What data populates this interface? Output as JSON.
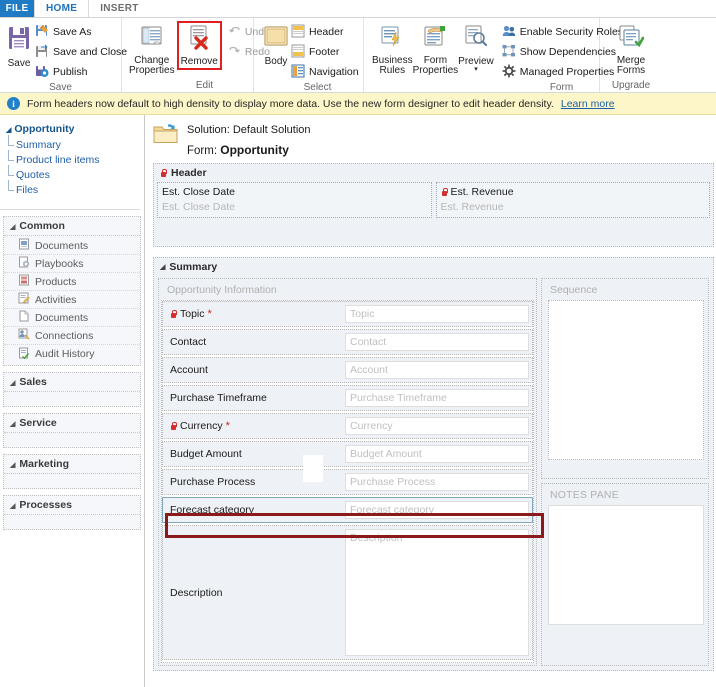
{
  "window": {
    "tabs": [
      {
        "label": "FILE",
        "state": "file"
      },
      {
        "label": "HOME",
        "state": "active"
      },
      {
        "label": "INSERT",
        "state": "inactive"
      }
    ]
  },
  "ribbon": {
    "groups": [
      {
        "name": "save",
        "label": "Save",
        "big": [
          {
            "label": "Save",
            "icon": "floppy-disk-icon"
          }
        ],
        "small": [
          {
            "label": "Save As",
            "icon": "save-as-icon"
          },
          {
            "label": "Save and Close",
            "icon": "save-and-close-icon"
          },
          {
            "label": "Publish",
            "icon": "publish-icon"
          }
        ]
      },
      {
        "name": "edit",
        "label": "Edit",
        "big": [
          {
            "label": "Change Properties",
            "icon": "change-properties-icon"
          },
          {
            "label": "Remove",
            "icon": "remove-icon",
            "highlighted": true
          }
        ],
        "small": [
          {
            "label": "Undo",
            "icon": "undo-icon",
            "disabled": true
          },
          {
            "label": "Redo",
            "icon": "redo-icon",
            "disabled": true
          }
        ]
      },
      {
        "name": "select",
        "label": "Select",
        "big": [
          {
            "label": "Body",
            "icon": "body-icon"
          }
        ],
        "small": [
          {
            "label": "Header",
            "icon": "header-icon"
          },
          {
            "label": "Footer",
            "icon": "footer-icon"
          },
          {
            "label": "Navigation",
            "icon": "navigation-icon"
          }
        ]
      },
      {
        "name": "form",
        "label": "Form",
        "big": [
          {
            "label": "Business Rules",
            "icon": "business-rules-icon"
          },
          {
            "label": "Form Properties",
            "icon": "form-properties-icon"
          },
          {
            "label": "Preview",
            "icon": "preview-icon",
            "dropdown": true
          }
        ],
        "small": [
          {
            "label": "Enable Security Roles",
            "icon": "security-roles-icon"
          },
          {
            "label": "Show Dependencies",
            "icon": "dependencies-icon"
          },
          {
            "label": "Managed Properties",
            "icon": "managed-properties-icon"
          }
        ]
      },
      {
        "name": "upgrade",
        "label": "Upgrade",
        "big": [
          {
            "label": "Merge Forms",
            "icon": "merge-forms-icon"
          }
        ],
        "small": []
      }
    ]
  },
  "notification": {
    "icon": "info-icon",
    "message": "Form headers now default to high density to display more data. Use the new form designer to edit header density.",
    "link_label": "Learn more"
  },
  "sidebar": {
    "root": {
      "label": "Opportunity",
      "children": [
        {
          "label": "Summary"
        },
        {
          "label": "Product line items"
        },
        {
          "label": "Quotes"
        },
        {
          "label": "Files"
        }
      ]
    },
    "groups": [
      {
        "label": "Common",
        "items": [
          {
            "label": "Documents",
            "icon": "documents-icon"
          },
          {
            "label": "Playbooks",
            "icon": "playbooks-icon"
          },
          {
            "label": "Products",
            "icon": "products-icon"
          },
          {
            "label": "Activities",
            "icon": "activities-icon"
          },
          {
            "label": "Documents",
            "icon": "documents-alt-icon"
          },
          {
            "label": "Connections",
            "icon": "connections-icon"
          },
          {
            "label": "Audit History",
            "icon": "audit-history-icon"
          }
        ]
      },
      {
        "label": "Sales",
        "items": []
      },
      {
        "label": "Service",
        "items": []
      },
      {
        "label": "Marketing",
        "items": []
      },
      {
        "label": "Processes",
        "items": []
      }
    ]
  },
  "designer": {
    "folder_icon": "solution-folder-icon",
    "solution_line": "Solution: Default Solution",
    "form_label": "Form:",
    "form_name": "Opportunity",
    "header_section": {
      "label": "Header",
      "locked": true,
      "fields": [
        {
          "label": "Est. Close Date",
          "placeholder": "Est. Close Date",
          "locked": false
        },
        {
          "label": "Est. Revenue",
          "placeholder": "Est. Revenue",
          "locked": true
        }
      ]
    },
    "summary_tab": {
      "label": "Summary",
      "left_column": {
        "header": "Opportunity Information",
        "fields": [
          {
            "label": "Topic",
            "placeholder": "Topic",
            "locked": true,
            "required": true
          },
          {
            "label": "Contact",
            "placeholder": "Contact",
            "locked": false,
            "required": false
          },
          {
            "label": "Account",
            "placeholder": "Account",
            "locked": false,
            "required": false
          },
          {
            "label": "Purchase Timeframe",
            "placeholder": "Purchase Timeframe",
            "locked": false,
            "required": false
          },
          {
            "label": "Currency",
            "placeholder": "Currency",
            "locked": true,
            "required": true
          },
          {
            "label": "Budget Amount",
            "placeholder": "Budget Amount",
            "locked": false,
            "required": false
          },
          {
            "label": "Purchase Process",
            "placeholder": "Purchase Process",
            "locked": false,
            "required": false
          },
          {
            "label": "Forecast category",
            "placeholder": "Forecast category",
            "locked": false,
            "required": false,
            "selected": true
          },
          {
            "label": "Description",
            "placeholder": "Description",
            "locked": false,
            "required": false,
            "tall": true
          }
        ]
      },
      "right_column": {
        "sequence_header": "Sequence",
        "notes_header": "NOTES PANE"
      }
    }
  },
  "colors": {
    "accent_blue": "#1e7bc4",
    "selection_red": "#8b1a1a",
    "notification_bg": "#fdf6c8",
    "required_red": "#cc2222",
    "lock_red": "#d32f2f"
  }
}
